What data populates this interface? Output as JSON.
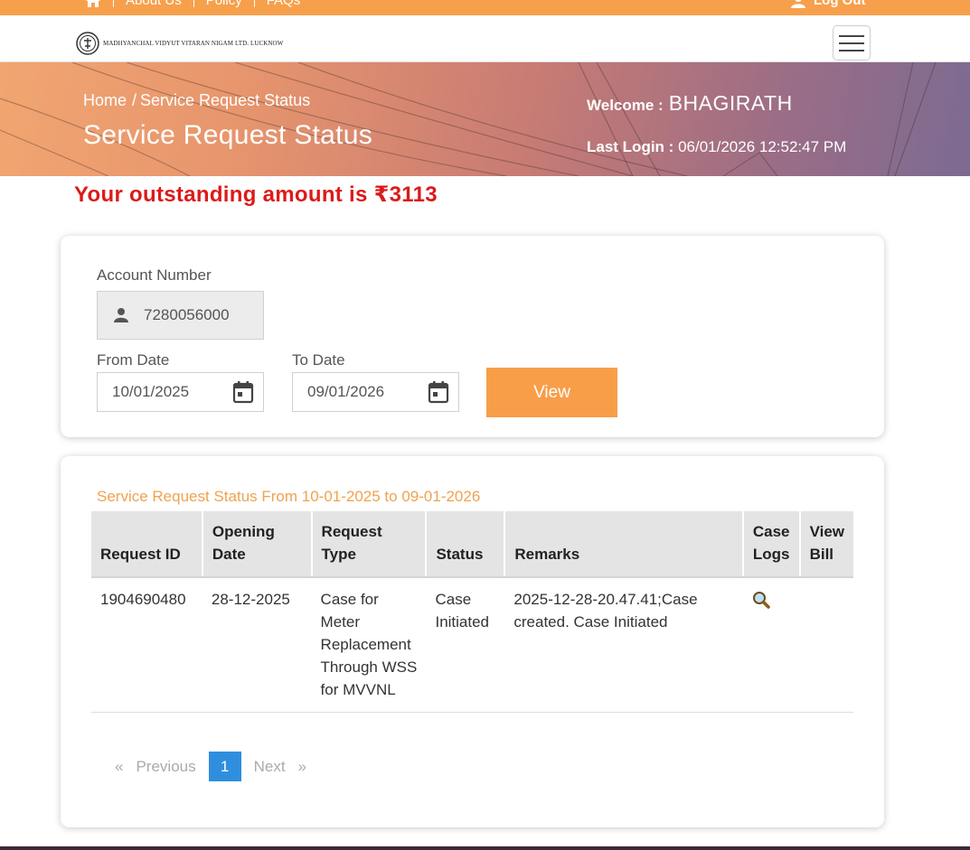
{
  "topbar": {
    "nav": [
      "About Us",
      "Policy",
      "FAQs"
    ],
    "logout_label": "Log Out"
  },
  "header": {
    "logo_text": "Madhyanchal Vidyut Vitaran Nigam Ltd. Lucknow"
  },
  "banner": {
    "breadcrumb_home": "Home",
    "breadcrumb_current": "Service Request Status",
    "title": "Service Request Status",
    "welcome_label": "Welcome :",
    "welcome_name": "BHAGIRATH",
    "last_login_label": "Last Login :",
    "last_login_value": "06/01/2026 12:52:47 PM"
  },
  "outstanding": "Your outstanding amount is ₹3113",
  "form": {
    "account_label": "Account Number",
    "account_value": "7280056000",
    "from_label": "From Date",
    "from_value": "10/01/2025",
    "to_label": "To Date",
    "to_value": "09/01/2026",
    "view_label": "View"
  },
  "results": {
    "title": "Service Request Status From 10-01-2025 to 09-01-2026",
    "columns": [
      "Request ID",
      "Opening Date",
      "Request Type",
      "Status",
      "Remarks",
      "Case Logs",
      "View Bill"
    ],
    "rows": [
      {
        "request_id": "1904690480",
        "opening_date": "28-12-2025",
        "request_type": "Case for Meter Replacement Through WSS for MVVNL",
        "status": "Case Initiated",
        "remarks": "2025-12-28-20.47.41;Case created. Case Initiated",
        "case_logs_icon": "magnifier-icon",
        "view_bill": ""
      }
    ],
    "pager": {
      "prev_arrow": "«",
      "previous": "Previous",
      "current_page": "1",
      "next": "Next",
      "next_arrow": "»"
    }
  },
  "colors": {
    "topbar": "#f7a04c",
    "accent_orange": "#f89e49",
    "alert_red": "#dc1a1a",
    "pager_blue": "#2f8fde"
  }
}
